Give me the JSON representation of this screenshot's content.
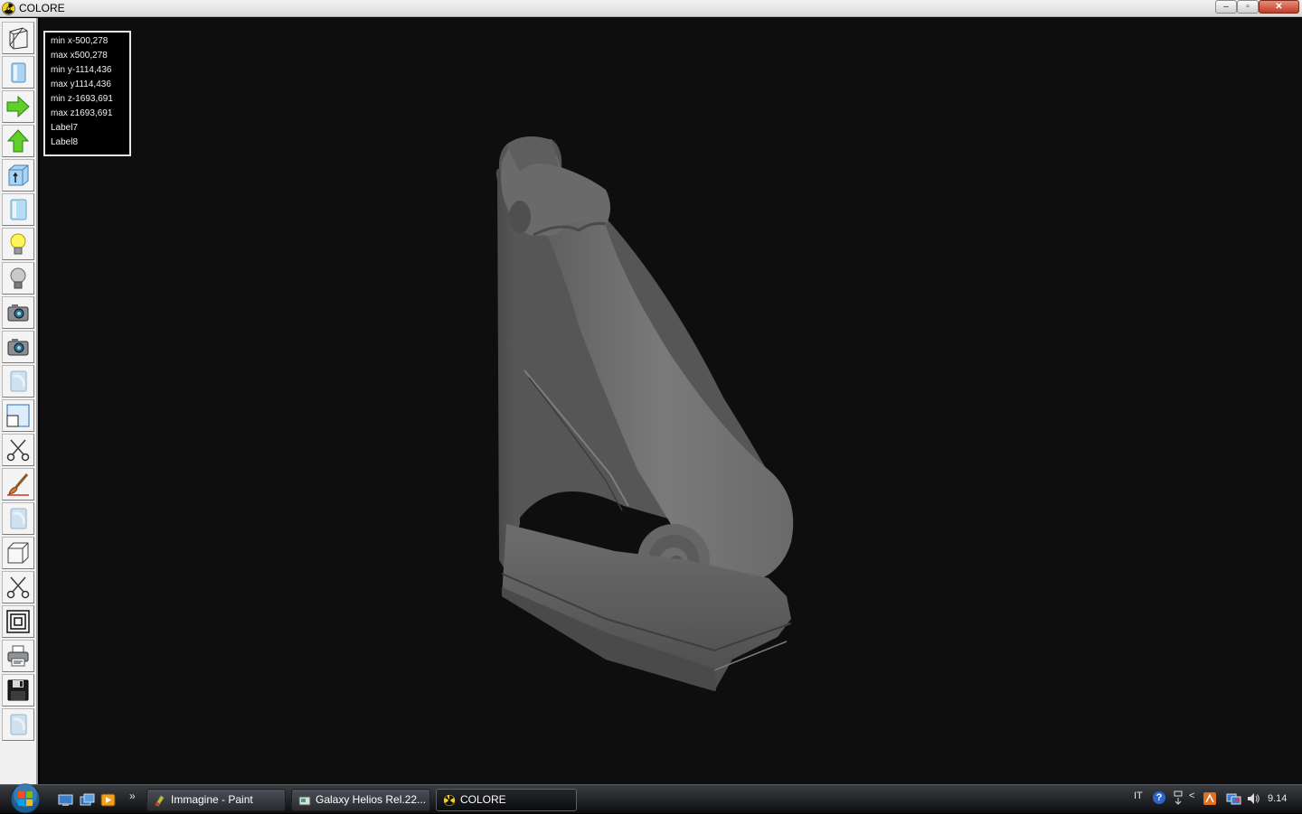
{
  "window": {
    "title": "COLORE"
  },
  "window_controls": {
    "minimize": "–",
    "maximize": "▫",
    "close": "✕"
  },
  "toolbar": {
    "tools": [
      "wireframe-icon",
      "solid-view-icon",
      "arrow-right-icon",
      "arrow-up-icon",
      "extrude-icon",
      "box-view-icon",
      "light-bulb-on-icon",
      "light-bulb-off-icon",
      "camera-icon",
      "camera-2-icon",
      "texture-icon",
      "window-frame-icon",
      "scissors-icon",
      "brush-icon",
      "texture-2-icon",
      "cube-icon",
      "scissors-2-icon",
      "concentric-squares-icon",
      "printer-icon",
      "save-disk-icon",
      "texture-3-icon"
    ]
  },
  "info": {
    "lines": [
      "min x-500,278",
      "max x500,278",
      "min y-1114,436",
      "max y1114,436",
      "min z-1693,691",
      "max z1693,691",
      "Label7",
      "Label8"
    ]
  },
  "taskbar": {
    "quicklaunch_more": "»",
    "tasks": [
      {
        "label": "Immagine - Paint"
      },
      {
        "label": "Galaxy Helios  Rel.22..."
      },
      {
        "label": "COLORE"
      }
    ],
    "tray": {
      "language": "IT",
      "help": "?",
      "show_more": "<",
      "clock": "9.14"
    }
  },
  "colors": {
    "viewport_bg": "#0e0e0e",
    "model_gray": "#6e6e6e"
  }
}
